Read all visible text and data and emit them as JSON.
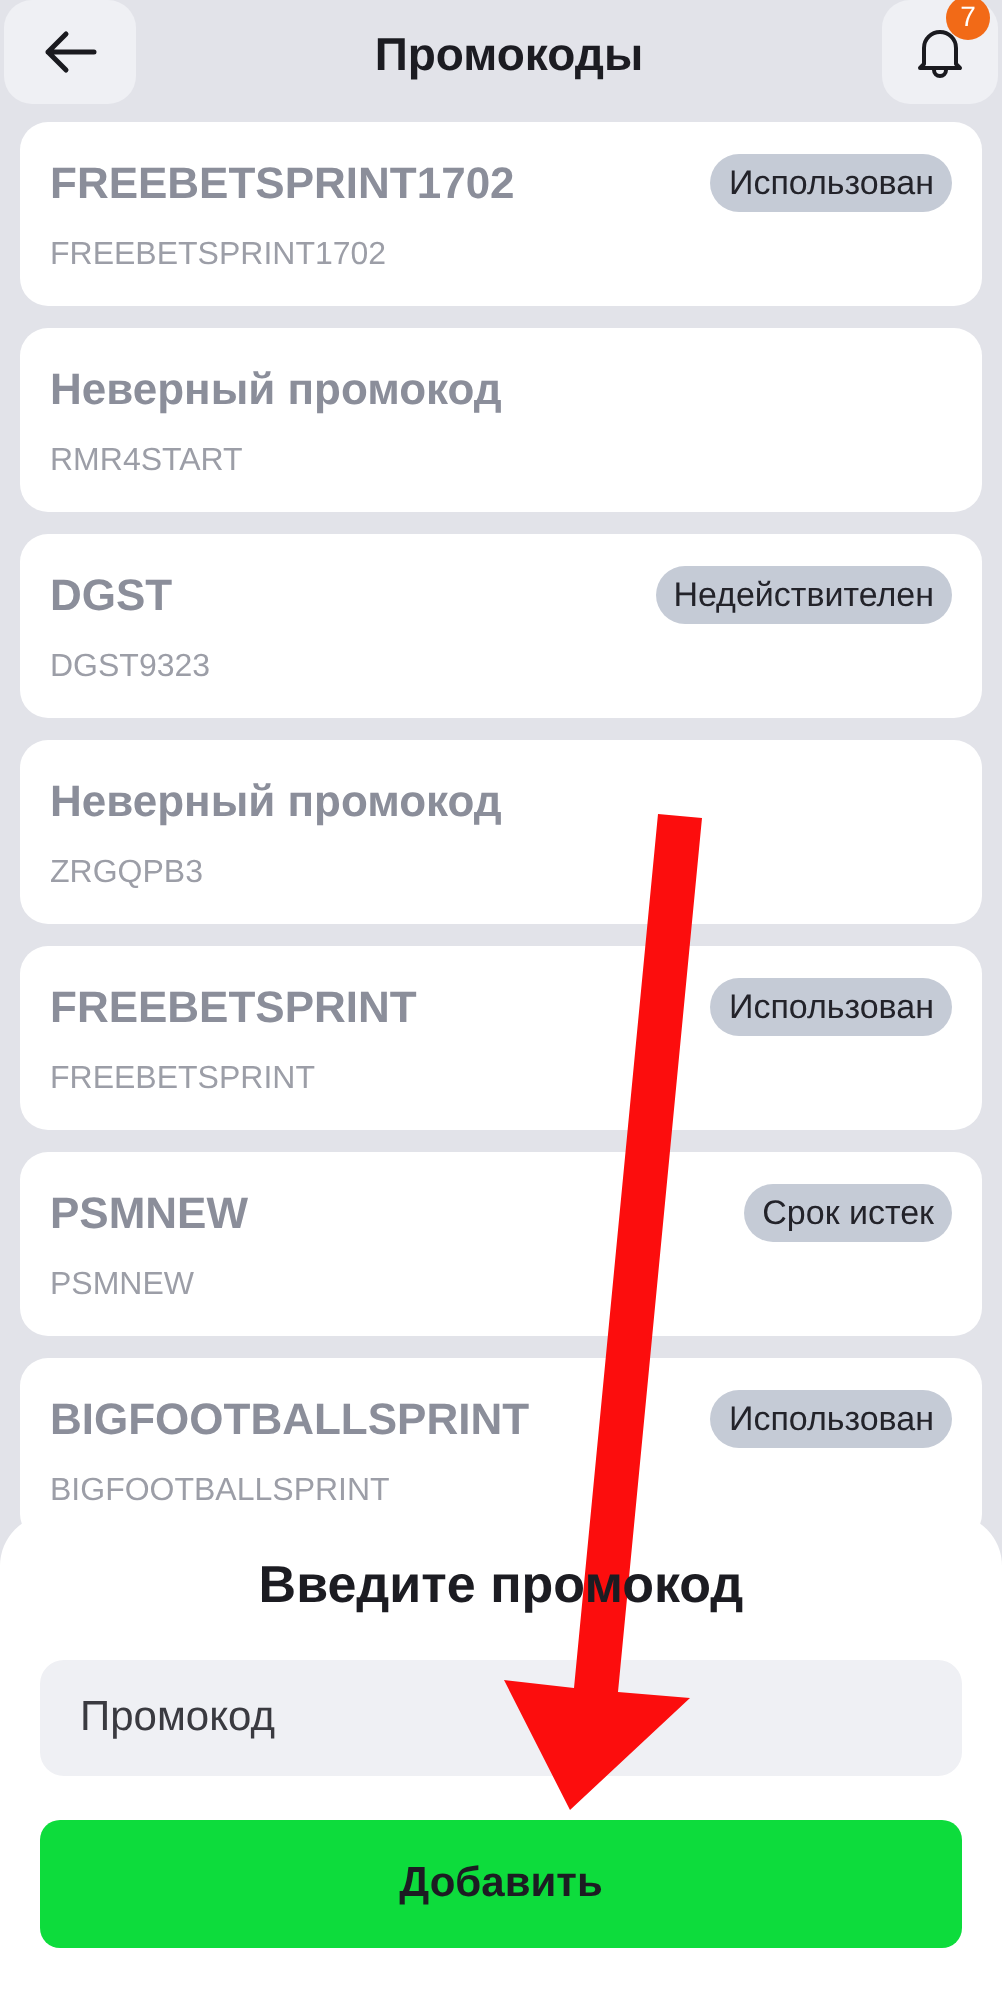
{
  "header": {
    "title": "Промокоды",
    "notification_count": "7"
  },
  "promocodes": [
    {
      "title": "FREEBETSPRINT1702",
      "code": "FREEBETSPRINT1702",
      "status": "Использован"
    },
    {
      "title": "Неверный промокод",
      "code": "RMR4START"
    },
    {
      "title": "DGST",
      "code": "DGST9323",
      "status": "Недействителен"
    },
    {
      "title": "Неверный промокод",
      "code": "ZRGQPB3"
    },
    {
      "title": "FREEBETSPRINT",
      "code": "FREEBETSPRINT",
      "status": "Использован"
    },
    {
      "title": "PSMNEW",
      "code": "PSMNEW",
      "status": "Срок истек"
    },
    {
      "title": "BIGFOOTBALLSPRINT",
      "code": "BIGFOOTBALLSPRINT",
      "status": "Использован"
    }
  ],
  "sheet": {
    "title": "Введите промокод",
    "field": {
      "placeholder": "Промокод"
    },
    "button": "Добавить"
  }
}
